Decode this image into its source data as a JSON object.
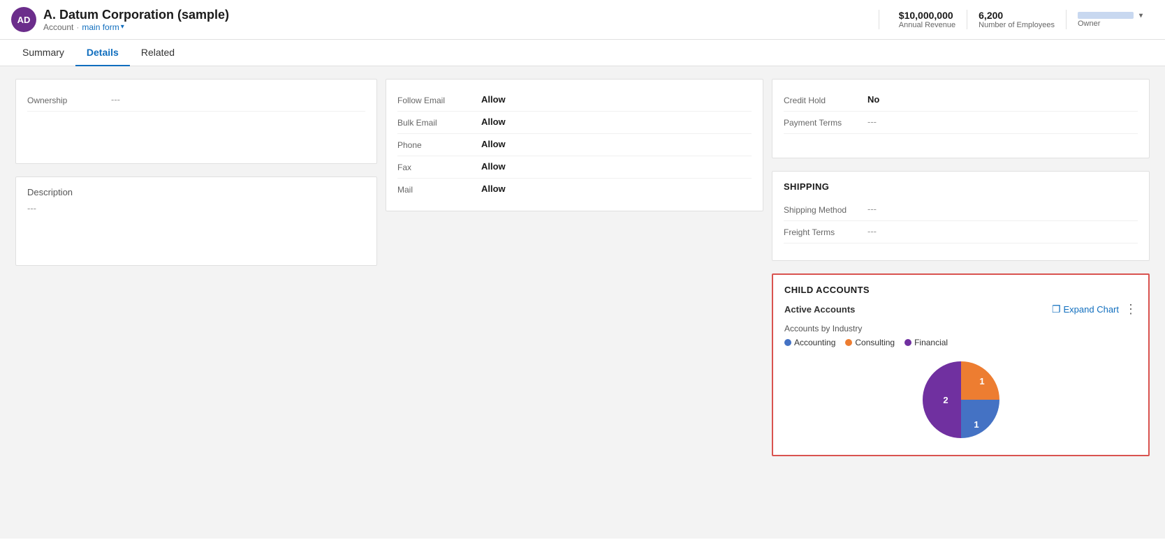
{
  "header": {
    "avatar_initials": "AD",
    "account_name": "A. Datum Corporation (sample)",
    "breadcrumb_type": "Account",
    "breadcrumb_form": "main form",
    "stats": {
      "revenue_value": "$10,000,000",
      "revenue_label": "Annual Revenue",
      "employees_value": "6,200",
      "employees_label": "Number of Employees",
      "owner_label": "Owner"
    }
  },
  "tabs": {
    "items": [
      {
        "id": "summary",
        "label": "Summary",
        "active": false
      },
      {
        "id": "details",
        "label": "Details",
        "active": true
      },
      {
        "id": "related",
        "label": "Related",
        "active": false
      }
    ]
  },
  "left_col": {
    "ownership_panel": {
      "field_label": "Ownership",
      "field_value": "---"
    },
    "description_panel": {
      "title": "Description",
      "value": "---"
    }
  },
  "middle_col": {
    "contact_preferences": {
      "fields": [
        {
          "label": "Follow Email",
          "value": "Allow"
        },
        {
          "label": "Bulk Email",
          "value": "Allow"
        },
        {
          "label": "Phone",
          "value": "Allow"
        },
        {
          "label": "Fax",
          "value": "Allow"
        },
        {
          "label": "Mail",
          "value": "Allow"
        }
      ]
    }
  },
  "right_col": {
    "billing_panel": {
      "fields": [
        {
          "label": "Credit Hold",
          "value": "No"
        },
        {
          "label": "Payment Terms",
          "value": "---"
        }
      ]
    },
    "shipping_panel": {
      "title": "SHIPPING",
      "fields": [
        {
          "label": "Shipping Method",
          "value": "---"
        },
        {
          "label": "Freight Terms",
          "value": "---"
        }
      ]
    },
    "child_accounts_panel": {
      "title": "CHILD ACCOUNTS",
      "chart_title": "Active Accounts",
      "expand_label": "Expand Chart",
      "chart_subtitle": "Accounts by Industry",
      "legend": [
        {
          "label": "Accounting",
          "color": "#4472C4"
        },
        {
          "label": "Consulting",
          "color": "#ED7D31"
        },
        {
          "label": "Financial",
          "color": "#7030A0"
        }
      ],
      "pie_segments": [
        {
          "label": "Accounting",
          "value": 1,
          "color": "#4472C4"
        },
        {
          "label": "Consulting",
          "value": 1,
          "color": "#ED7D31"
        },
        {
          "label": "Financial",
          "value": 2,
          "color": "#7030A0"
        }
      ]
    }
  }
}
